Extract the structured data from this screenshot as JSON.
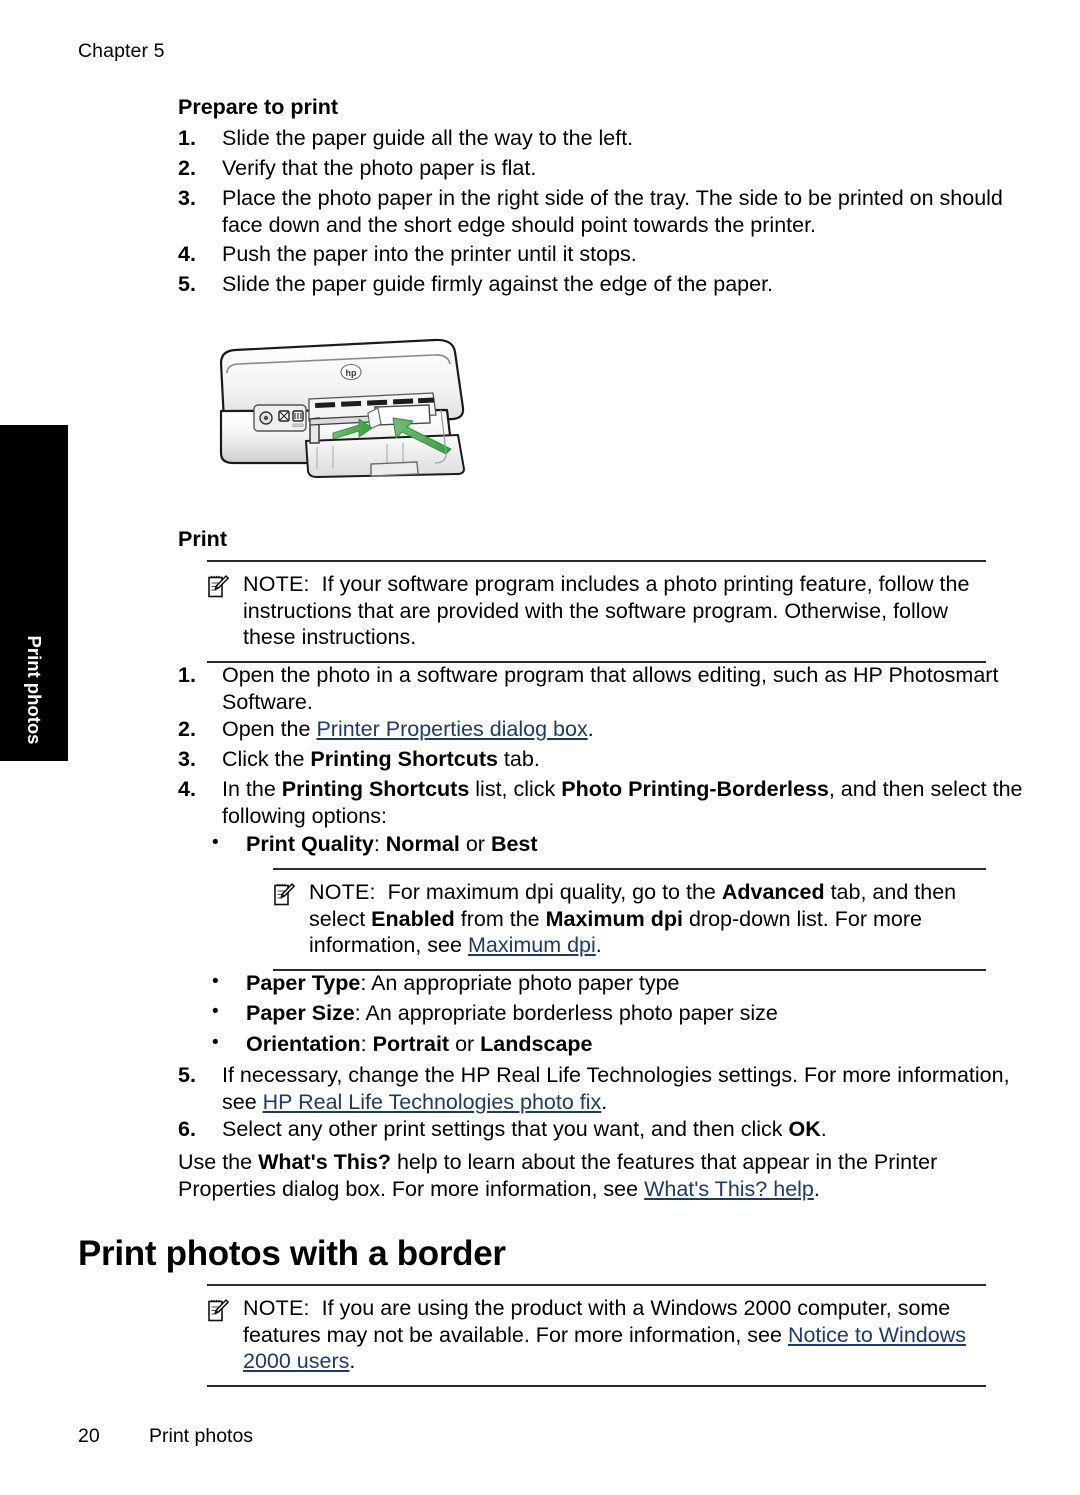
{
  "page": {
    "chapter_header": "Chapter 5",
    "footer_page_number": "20",
    "footer_section": "Print photos",
    "side_tab_label": "Print photos",
    "link_color": "#1b3b6f"
  },
  "prepare_section": {
    "heading": "Prepare to print",
    "steps": [
      {
        "num": "1.",
        "text": "Slide the paper guide all the way to the left."
      },
      {
        "num": "2.",
        "text": "Verify that the photo paper is flat."
      },
      {
        "num": "3.",
        "text": "Place the photo paper in the right side of the tray. The side to be printed on should face down and the short edge should point towards the printer."
      },
      {
        "num": "4.",
        "text": "Push the paper into the printer until it stops."
      },
      {
        "num": "5.",
        "text": "Slide the paper guide firmly against the edge of the paper."
      }
    ]
  },
  "figure": {
    "name": "hp-deskjet-printer-loading-photo-paper",
    "alt": "HP Deskjet printer with paper tray open and green arrows showing paper guide and paper insertion direction"
  },
  "print_section": {
    "heading": "Print",
    "note1": {
      "label": "NOTE:",
      "text": "If your software program includes a photo printing feature, follow the instructions that are provided with the software program. Otherwise, follow these instructions."
    },
    "step1": {
      "num": "1.",
      "text": "Open the photo in a software program that allows editing, such as HP Photosmart Software."
    },
    "step2": {
      "num": "2.",
      "prefix": "Open the ",
      "link": "Printer Properties dialog box",
      "suffix": "."
    },
    "step3": {
      "num": "3.",
      "prefix": "Click the ",
      "bold": "Printing Shortcuts",
      "suffix": " tab."
    },
    "step4": {
      "num": "4.",
      "p1": "In the ",
      "b1": "Printing Shortcuts",
      "p2": " list, click ",
      "b2": "Photo Printing-Borderless",
      "p3": ", and then select the following options:"
    },
    "bullets": [
      {
        "bullet": "•",
        "label": "Print Quality",
        "sep": ": ",
        "v1": "Normal",
        "mid": " or ",
        "v2": "Best",
        "bold_value": true
      },
      {
        "bullet": "•",
        "label": "Paper Type",
        "sep": ": ",
        "v1": "An appropriate photo paper type",
        "mid": "",
        "v2": "",
        "bold_value": false
      },
      {
        "bullet": "•",
        "label": "Paper Size",
        "sep": ": ",
        "v1": "An appropriate borderless photo paper size",
        "mid": "",
        "v2": "",
        "bold_value": false
      },
      {
        "bullet": "•",
        "label": "Orientation",
        "sep": ": ",
        "v1": "Portrait",
        "mid": " or ",
        "v2": "Landscape",
        "bold_value": true
      }
    ],
    "note2": {
      "label": "NOTE:",
      "t1": "For maximum dpi quality, go to the ",
      "b1": "Advanced",
      "t2": " tab, and then select ",
      "b2": "Enabled",
      "t3": " from the ",
      "b3": "Maximum dpi",
      "t4": " drop-down list. For more information, see ",
      "link": "Maximum dpi",
      "t5": "."
    },
    "step5": {
      "num": "5.",
      "prefix": "If necessary, change the HP Real Life Technologies settings. For more information, see ",
      "link": "HP Real Life Technologies photo fix",
      "suffix": "."
    },
    "step6": {
      "num": "6.",
      "prefix": "Select any other print settings that you want, and then click ",
      "bold": "OK",
      "suffix": "."
    },
    "closing_paragraph": {
      "p1": "Use the ",
      "b1": "What's This?",
      "p2": " help to learn about the features that appear in the Printer Properties dialog box. For more information, see ",
      "link": "What's This? help",
      "p3": "."
    }
  },
  "border_section": {
    "heading": "Print photos with a border",
    "note": {
      "label": "NOTE:",
      "prefix": "If you are using the product with a Windows 2000 computer, some features may not be available. For more information, see ",
      "link": "Notice to Windows 2000 users",
      "suffix": "."
    }
  },
  "icons": {
    "note_icon": "notepad-pencil-icon"
  }
}
